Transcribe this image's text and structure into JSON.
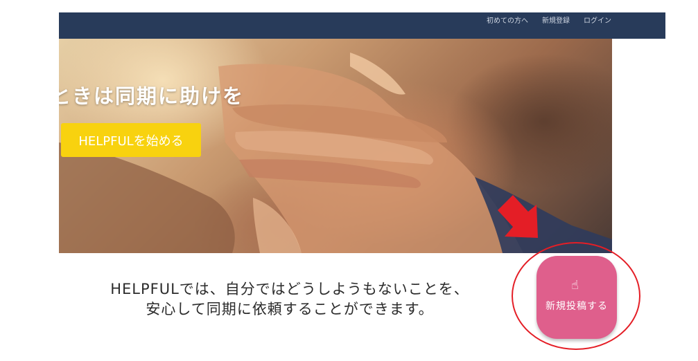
{
  "nav": {
    "links": [
      "初めての方へ",
      "新規登録",
      "ログイン"
    ],
    "background": "#283b5a"
  },
  "hero": {
    "title": "ときは同期に助けを",
    "cta_label": "HELPFULを始める",
    "cta_color": "#f8d20f"
  },
  "tagline": {
    "line1": "HELPFULでは、自分ではどうしようもないことを、",
    "line2": "安心して同期に依頼することができます。"
  },
  "post_button": {
    "icon": "hand-pointer-icon",
    "label": "新規投稿する",
    "color": "#df5f8c"
  },
  "annotations": {
    "arrow_color": "#e41e26",
    "circle_color": "#e41e26"
  }
}
